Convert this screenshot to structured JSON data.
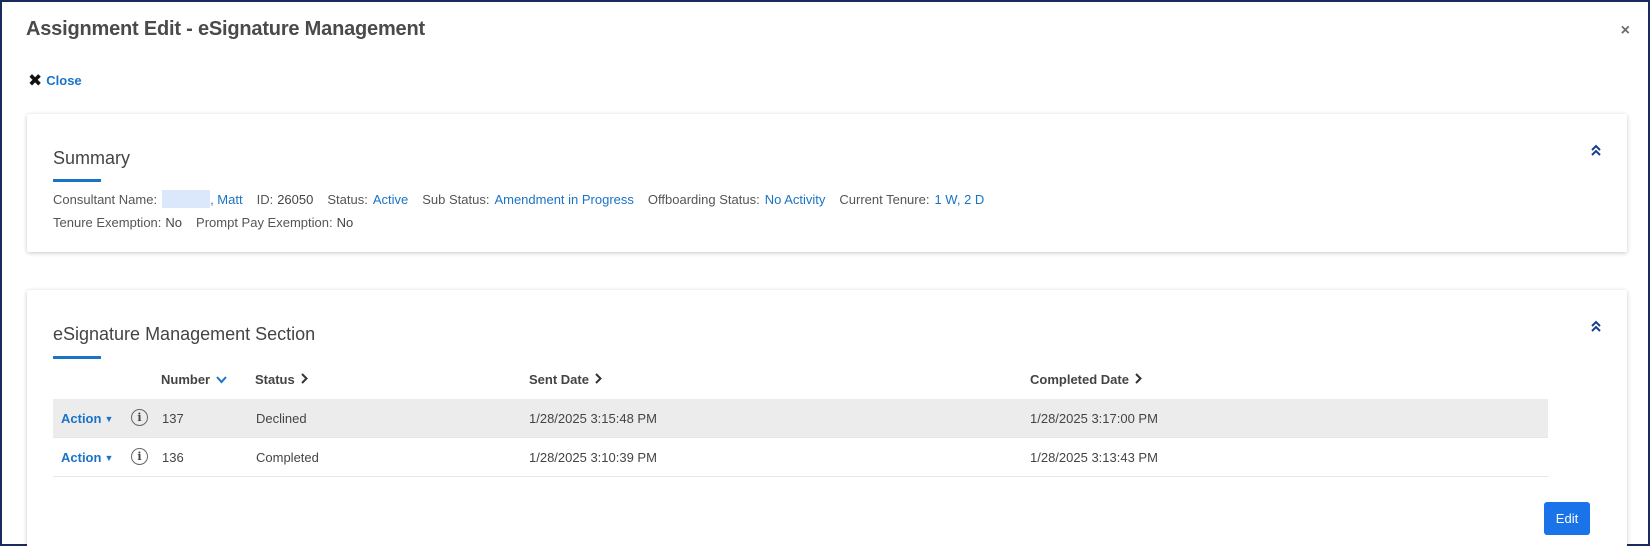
{
  "modal": {
    "title": "Assignment Edit - eSignature Management",
    "close_x": "×",
    "close_icon": "✖",
    "close_label": "Close"
  },
  "summary": {
    "title": "Summary",
    "collapse_icon": "chevron-double-up",
    "consultant_label": "Consultant Name:",
    "consultant_value": ", Matt",
    "id_label": "ID:",
    "id_value": "26050",
    "status_label": "Status:",
    "status_value": "Active",
    "sub_status_label": "Sub Status:",
    "sub_status_value": "Amendment in Progress",
    "offboarding_label": "Offboarding Status:",
    "offboarding_value": "No Activity",
    "tenure_label": "Current Tenure:",
    "tenure_value": "1 W, 2 D",
    "tenure_exemption_label": "Tenure Exemption:",
    "tenure_exemption_value": "No",
    "prompt_pay_label": "Prompt Pay Exemption:",
    "prompt_pay_value": "No"
  },
  "esig": {
    "title": "eSignature Management Section",
    "collapse_icon": "chevron-double-up",
    "columns": {
      "number": "Number",
      "status": "Status",
      "sent": "Sent Date",
      "completed": "Completed Date"
    },
    "rows": [
      {
        "action": "Action",
        "number": "137",
        "status": "Declined",
        "sent": "1/28/2025 3:15:48 PM",
        "completed": "1/28/2025 3:17:00 PM"
      },
      {
        "action": "Action",
        "number": "136",
        "status": "Completed",
        "sent": "1/28/2025 3:10:39 PM",
        "completed": "1/28/2025 3:13:43 PM"
      }
    ],
    "edit_label": "Edit"
  },
  "colors": {
    "accent": "#1a73c7",
    "button": "#1a73e8",
    "row_highlight": "#ececec"
  }
}
